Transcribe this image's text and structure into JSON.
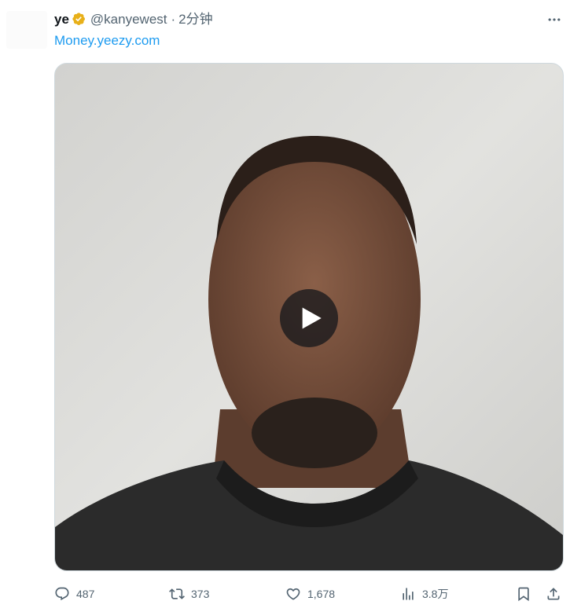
{
  "tweet": {
    "display_name": "ye",
    "handle": "@kanyewest",
    "separator": "·",
    "time": "2分钟",
    "link_text": "Money.yeezy.com"
  },
  "actions": {
    "replies": "487",
    "retweets": "373",
    "likes": "1,678",
    "views": "3.8万"
  },
  "icons": {
    "verified": "verified-badge-icon",
    "more": "more-icon",
    "play": "play-icon",
    "reply": "reply-icon",
    "retweet": "retweet-icon",
    "like": "heart-icon",
    "views": "views-chart-icon",
    "bookmark": "bookmark-icon",
    "share": "share-icon"
  },
  "colors": {
    "text": "#0f1419",
    "secondary": "#536471",
    "link": "#1d9bf0",
    "verified_badge": "#e8b019",
    "border": "#cfd9de"
  }
}
